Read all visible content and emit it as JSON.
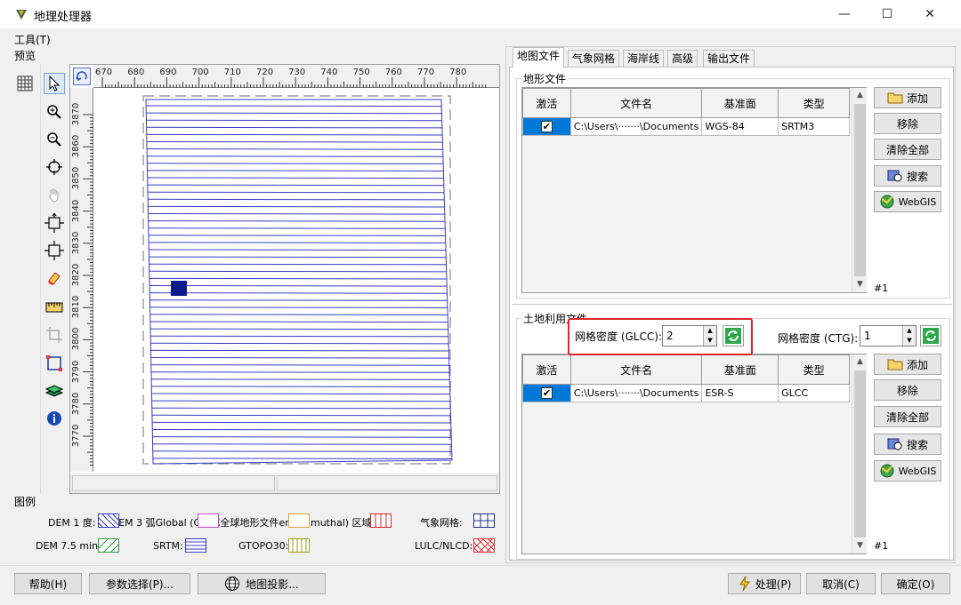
{
  "window": {
    "title": "地理处理器",
    "minimize": "—",
    "maximize": "☐",
    "close": "✕"
  },
  "menu": {
    "tools": "工具(T)"
  },
  "preview": {
    "label": "预览",
    "ruler_top": [
      "670",
      "680",
      "690",
      "700",
      "710",
      "720",
      "730",
      "740",
      "750",
      "760",
      "770",
      "780"
    ],
    "ruler_left": [
      "3870",
      "3860",
      "3850",
      "3840",
      "3830",
      "3820",
      "3810",
      "3800",
      "3790",
      "3780",
      "3770"
    ],
    "tools": [
      "grid-icon",
      "select-arrow-icon",
      "zoom-in-icon",
      "zoom-out-icon",
      "center-icon",
      "pan-hand-icon",
      "fit-extent-icon",
      "fit-selection-icon",
      "eraser-icon",
      "ruler-icon",
      "crop-icon",
      "select-region-icon",
      "layers-icon",
      "info-icon"
    ]
  },
  "legend": {
    "label": "图例",
    "items": [
      {
        "label": "DEM 1 度:"
      },
      {
        "label": "LULC GCS Global (GLCC) (Lambert Azimuthal) 区域:"
      },
      {
        "label": "DEM 7.5 min:"
      },
      {
        "label": "SRTM:"
      },
      {
        "label": "GTOPO30:"
      },
      {
        "label": "LULC/NLCD:"
      },
      {
        "label": "DEM 3 弧秒:"
      },
      {
        "label": "气象网格:"
      },
      {
        "label": "全球地形文件"
      }
    ],
    "row1_overlap_text": "DEM 1 度: LUDEM 3 弧Global (GLCC全球地形文件ert Azimuthal) 区域:",
    "met_grid": "气象网格:",
    "dem75": "DEM 7.5 min:",
    "srtm": "SRTM:",
    "gtopo": "GTOPO30:",
    "lulc": "LULC/NLCD:"
  },
  "tabs": [
    "地图文件",
    "气象网格",
    "海岸线",
    "高级",
    "输出文件"
  ],
  "terrain": {
    "section_label": "地形文件",
    "headers": [
      "激活",
      "文件名",
      "基准面",
      "类型"
    ],
    "rows": [
      {
        "active": "✔",
        "filename": "C:\\Users\\·······\\Documents",
        "datum": "WGS-84",
        "type": "SRTM3"
      }
    ],
    "counter": "#1",
    "buttons": {
      "add": "添加",
      "remove": "移除",
      "clear": "清除全部",
      "search": "搜索",
      "webgis": "WebGIS"
    }
  },
  "landuse": {
    "section_label": "土地利用文件",
    "glcc_label": "网格密度 (GLCC):",
    "glcc_value": "2",
    "ctg_label": "网格密度 (CTG):",
    "ctg_value": "1",
    "headers": [
      "激活",
      "文件名",
      "基准面",
      "类型"
    ],
    "rows": [
      {
        "active": "✔",
        "filename": "C:\\Users\\·······\\Documents",
        "datum": "ESR-S",
        "type": "GLCC"
      }
    ],
    "counter": "#1",
    "buttons": {
      "add": "添加",
      "remove": "移除",
      "clear": "清除全部",
      "search": "搜索",
      "webgis": "WebGIS"
    }
  },
  "bottom": {
    "help": "帮助(H)",
    "params": "参数选择(P)...",
    "projection": "地图投影...",
    "process": "处理(P)",
    "cancel": "取消(C)",
    "ok": "确定(O)"
  },
  "colors": {
    "highlight": "#e0242a",
    "map_line": "#3a3ac8",
    "selection": "#0078d7"
  }
}
